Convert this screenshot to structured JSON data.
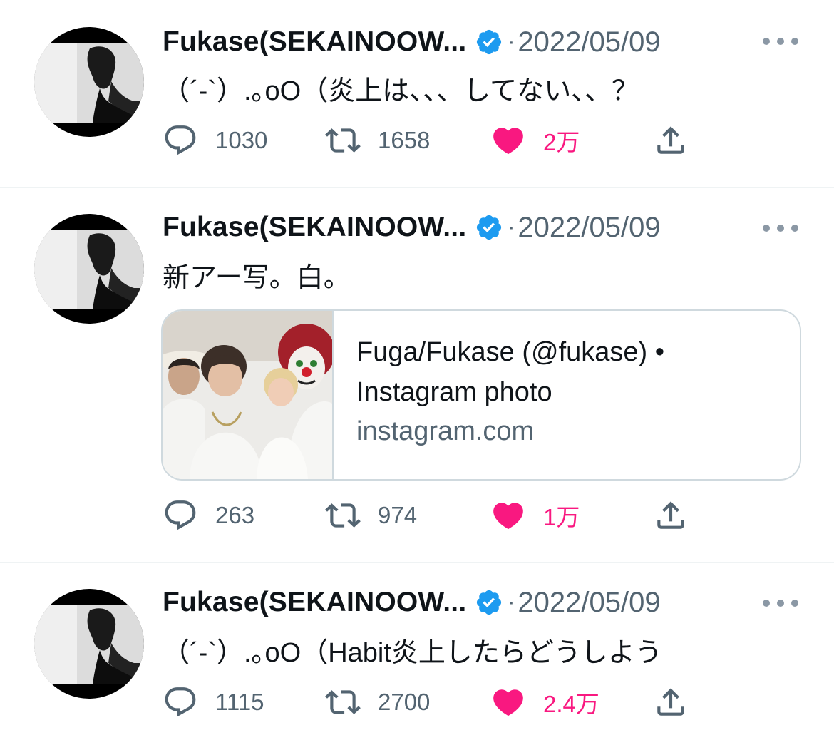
{
  "colors": {
    "like": "#f91880",
    "verified": "#1d9bf0",
    "secondary": "#536471"
  },
  "tweets": [
    {
      "name": "Fukase(SEKAINOOW...",
      "dot": "·",
      "date": "2022/05/09",
      "text": "（´-`）.｡oO（炎上は、、、してない、、？",
      "replies": "1030",
      "retweets": "1658",
      "likes": "2万"
    },
    {
      "name": "Fukase(SEKAINOOW...",
      "dot": "·",
      "date": "2022/05/09",
      "text": "新アー写。白。",
      "card": {
        "title_line1": "Fuga/Fukase (@fukase) •",
        "title_line2": "Instagram photo",
        "domain": "instagram.com"
      },
      "replies": "263",
      "retweets": "974",
      "likes": "1万"
    },
    {
      "name": "Fukase(SEKAINOOW...",
      "dot": "·",
      "date": "2022/05/09",
      "text": "（´-`）.｡oO（Habit炎上したらどうしよう",
      "replies": "1115",
      "retweets": "2700",
      "likes": "2.4万"
    }
  ]
}
